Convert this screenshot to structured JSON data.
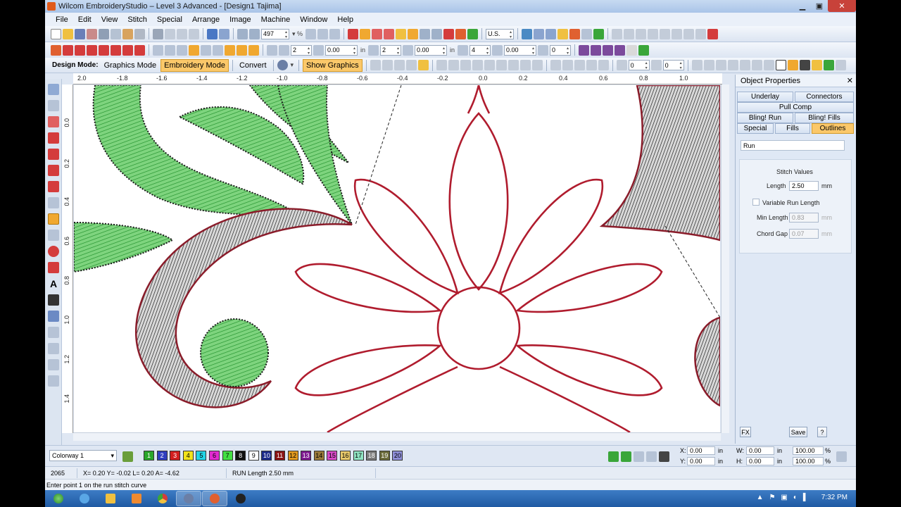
{
  "title": "Wilcom EmbroideryStudio – Level 3 Advanced - [Design1      Tajima]",
  "menu": [
    "File",
    "Edit",
    "View",
    "Stitch",
    "Special",
    "Arrange",
    "Image",
    "Machine",
    "Window",
    "Help"
  ],
  "toolbar1": {
    "zoom": "497",
    "units": "U.S."
  },
  "toolbar2": {
    "count1": "2",
    "v1": "0.00",
    "label_in": "in",
    "count2": "2",
    "v2": "0.00",
    "label_in2": "in",
    "count3": "4",
    "v3": "0.00",
    "count4": "0"
  },
  "modebar": {
    "label": "Design Mode:",
    "graphics": "Graphics Mode",
    "embroidery": "Embroidery Mode",
    "convert": "Convert",
    "show_graphics": "Show Graphics",
    "v1": "0",
    "v2": "0"
  },
  "ruler_top": [
    "2.0",
    "-1.8",
    "-1.6",
    "-1.4",
    "-1.2",
    "-1.0",
    "-0.8",
    "-0.6",
    "-0.4",
    "-0.2",
    "0.0",
    "0.2",
    "0.4",
    "0.6",
    "0.8",
    "1.0"
  ],
  "ruler_left": [
    "0.0",
    "0.2",
    "0.4",
    "0.6",
    "0.8",
    "1.0",
    "1.2",
    "1.4"
  ],
  "panel": {
    "title": "Object Properties",
    "tabs": [
      {
        "label": "Underlay",
        "active": false
      },
      {
        "label": "Connectors",
        "active": false
      },
      {
        "label": "Pull Comp",
        "active": false
      },
      {
        "label": "Bling! Run",
        "active": false
      },
      {
        "label": "Bling! Fills",
        "active": false
      },
      {
        "label": "Special",
        "active": false
      },
      {
        "label": "Fills",
        "active": false
      },
      {
        "label": "Outlines",
        "active": true
      }
    ],
    "select": "Run",
    "section": "Stitch Values",
    "length_label": "Length",
    "length_value": "2.50",
    "length_unit": "mm",
    "variable_label": "Variable Run Length",
    "min_label": "Min Length",
    "min_value": "0.83",
    "chord_label": "Chord Gap",
    "chord_value": "0.07",
    "unit_mm": "mm",
    "fx": "FX",
    "save": "Save",
    "help": "?"
  },
  "colorway": "Colorway 1",
  "palette": [
    {
      "n": "1",
      "c": "#2aa62a"
    },
    {
      "n": "2",
      "c": "#2f3fbf"
    },
    {
      "n": "3",
      "c": "#d21f1f"
    },
    {
      "n": "4",
      "c": "#f2e21a"
    },
    {
      "n": "5",
      "c": "#21d4e6"
    },
    {
      "n": "6",
      "c": "#e22ad0"
    },
    {
      "n": "7",
      "c": "#43e043"
    },
    {
      "n": "8",
      "c": "#111111"
    },
    {
      "n": "9",
      "c": "#ffffff"
    },
    {
      "n": "10",
      "c": "#1b2a8a"
    },
    {
      "n": "11",
      "c": "#8a1414"
    },
    {
      "n": "12",
      "c": "#e39a1e"
    },
    {
      "n": "13",
      "c": "#7d1a8f"
    },
    {
      "n": "14",
      "c": "#9a7a3a"
    },
    {
      "n": "15",
      "c": "#d849c7"
    },
    {
      "n": "16",
      "c": "#e9c96a"
    },
    {
      "n": "17",
      "c": "#8fe3c2"
    },
    {
      "n": "18",
      "c": "#7a7a7a"
    },
    {
      "n": "19",
      "c": "#6b6b3a"
    },
    {
      "n": "20",
      "c": "#8f8fd8"
    }
  ],
  "coords": {
    "x_label": "X:",
    "x": "0.00",
    "y_label": "Y:",
    "y": "0.00",
    "w_label": "W:",
    "w": "0.00",
    "h_label": "H:",
    "h": "0.00",
    "unit": "in",
    "pct1": "100.00",
    "pct2": "100.00",
    "pct": "%"
  },
  "status": {
    "count": "2065",
    "xy": "X=  0.20 Y=  -0.02 L=  0.20 A= -4.62",
    "run": "RUN Length  2.50 mm"
  },
  "prompt": "Enter point 1 on the run stitch curve",
  "clock": "7:32 PM"
}
